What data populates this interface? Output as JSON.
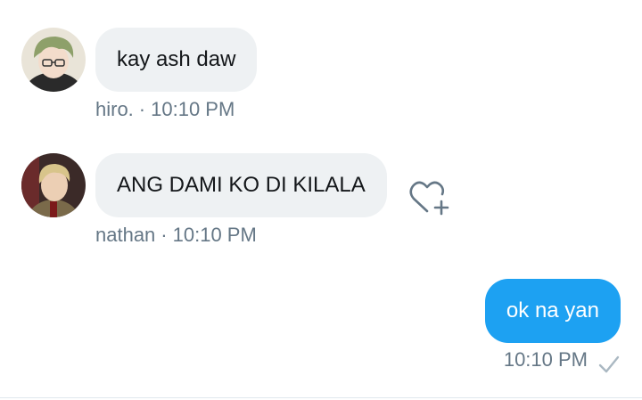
{
  "messages": [
    {
      "sender": "hiro.",
      "text": "kay ash daw",
      "time": "10:10 PM",
      "separator": "·"
    },
    {
      "sender": "nathan",
      "text": "ANG DAMI KO DI KILALA",
      "time": "10:10 PM",
      "separator": "·"
    },
    {
      "sender": "",
      "text": "ok na yan",
      "time": "10:10 PM"
    }
  ],
  "icons": {
    "react": "heart-plus-icon",
    "status": "checkmark-icon"
  },
  "colors": {
    "incoming_bubble": "#eef1f3",
    "outgoing_bubble": "#1da1f2",
    "meta_text": "#657786"
  }
}
